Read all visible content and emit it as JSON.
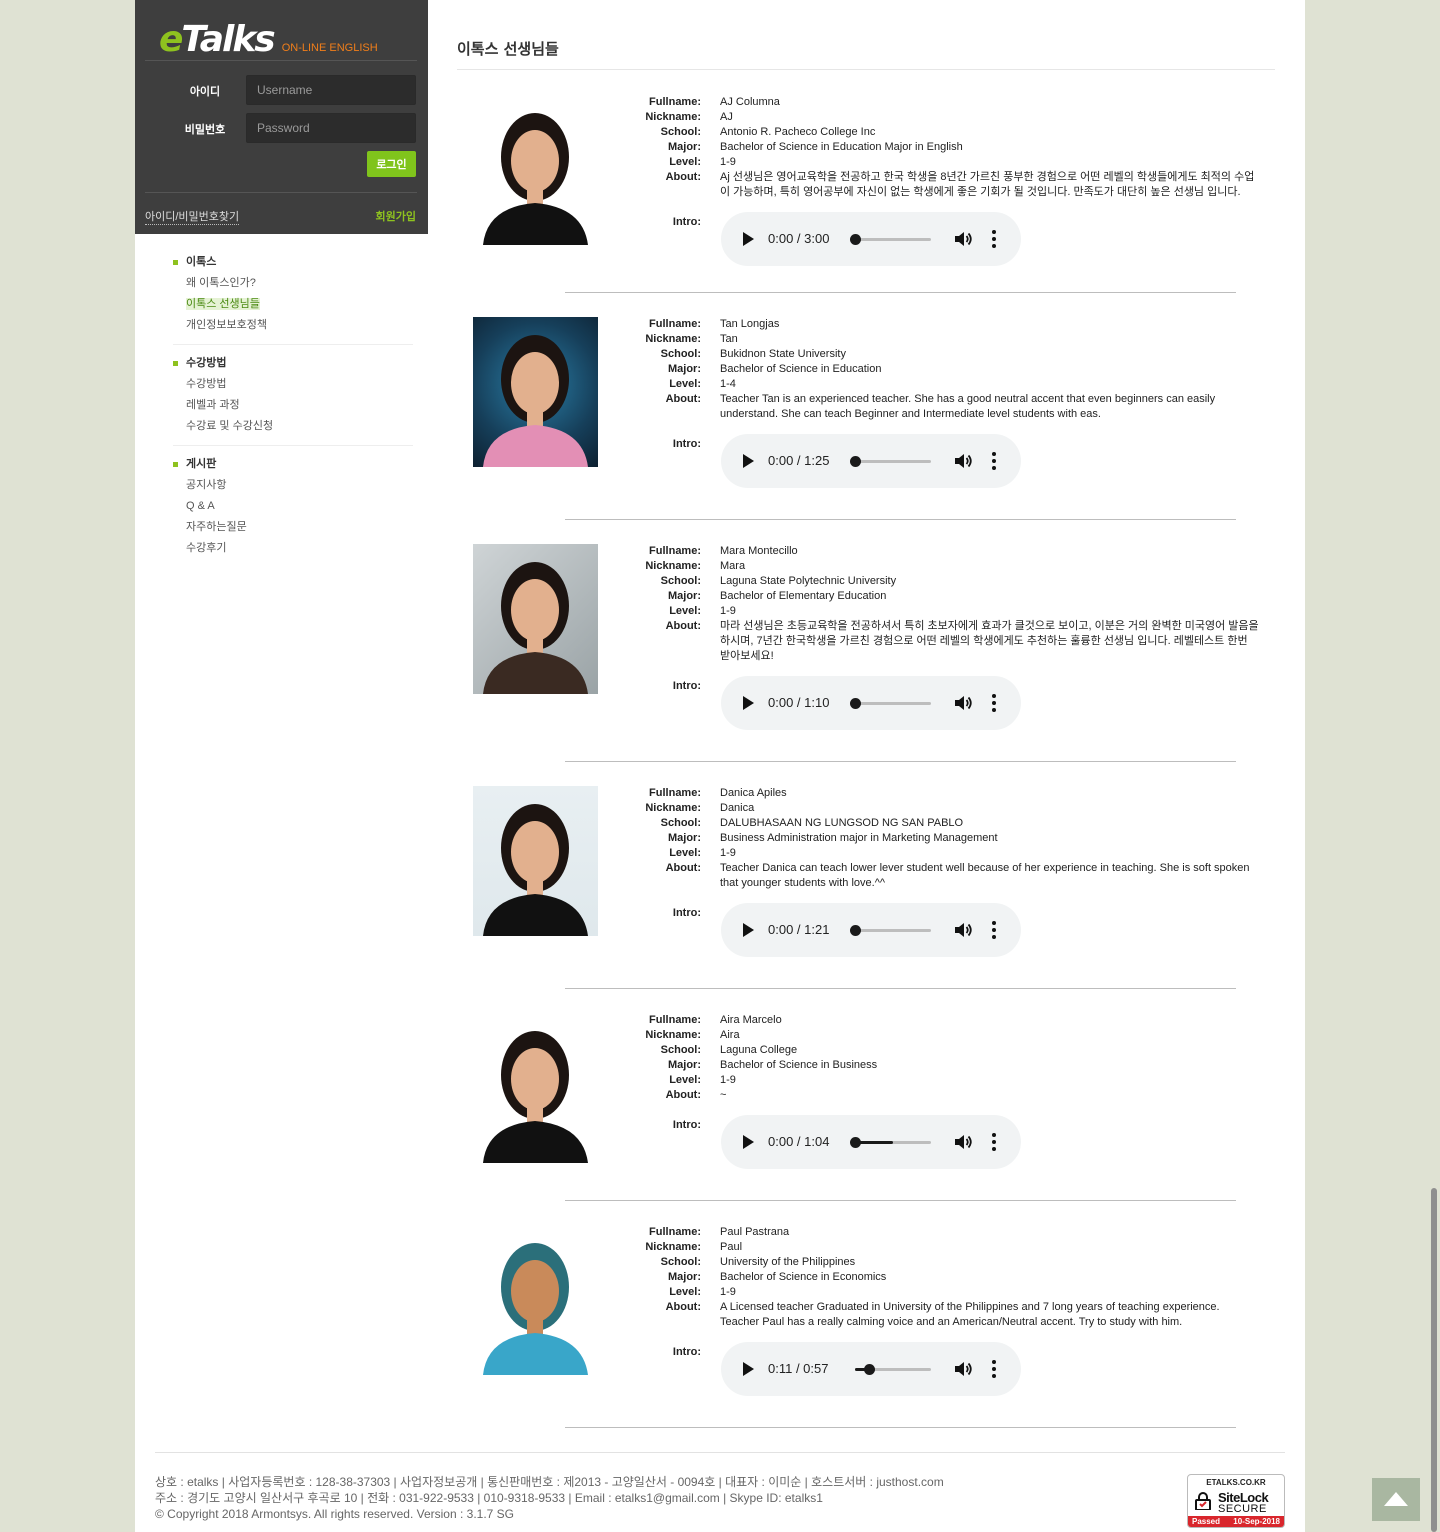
{
  "logo": {
    "e": "e",
    "talks": "Talks",
    "sub": "ON-LINE ENGLISH"
  },
  "login": {
    "id_label": "아이디",
    "id_placeholder": "Username",
    "pw_label": "비밀번호",
    "pw_placeholder": "Password",
    "button": "로그인",
    "find": "아이디/비밀번호찾기",
    "join": "회원가입"
  },
  "menu": [
    {
      "head": "이톡스",
      "items": [
        "왜 이톡스인가?",
        "이톡스 선생님들",
        "개인정보보호정책"
      ]
    },
    {
      "head": "수강방법",
      "items": [
        "수강방법",
        "레벨과 과정",
        "수강료 및 수강신청"
      ]
    },
    {
      "head": "게시판",
      "items": [
        "공지사항",
        "Q & A",
        "자주하는질문",
        "수강후기"
      ]
    }
  ],
  "page_title": "이톡스 선생님들",
  "labels": {
    "fullname": "Fullname:",
    "nickname": "Nickname:",
    "school": "School:",
    "major": "Major:",
    "level": "Level:",
    "about": "About:",
    "intro": "Intro:"
  },
  "teachers": [
    {
      "fullname": "AJ Columna",
      "nickname": "AJ",
      "school": "Antonio R. Pacheco College Inc",
      "major": "Bachelor of Science in Education Major in English",
      "level": "1-9",
      "about": "Aj 선생님은 영어교육학을 전공하고 한국 학생을 8년간 가르친 풍부한 경험으로 어떤 레벨의 학생들에게도 최적의 수업이 가능하며, 특히 영어공부에 자신이 없는 학생에게 좋은 기회가 될 것입니다. 만족도가 대단히 높은 선생님 입니다.",
      "audio_time": "0:00 / 3:00",
      "progress": 0.0
    },
    {
      "fullname": "Tan Longjas",
      "nickname": "Tan",
      "school": "Bukidnon State University",
      "major": "Bachelor of Science in Education",
      "level": "1-4",
      "about": "Teacher Tan is an experienced teacher. She has a good neutral accent that even beginners can easily understand. She can teach Beginner and Intermediate level students with eas.",
      "audio_time": "0:00 / 1:25",
      "progress": 0.0
    },
    {
      "fullname": "Mara Montecillo",
      "nickname": "Mara",
      "school": "Laguna State Polytechnic University",
      "major": "Bachelor of Elementary Education",
      "level": "1-9",
      "about": "마라 선생님은 초등교육학을 전공하셔서 특히 초보자에게 효과가 클것으로 보이고, 이분은 거의 완벽한 미국영어 발음을 하시며, 7년간 한국학생을 가르친 경험으로 어떤 레벨의 학생에게도 추천하는 훌륭한 선생님 입니다. 레벨테스트 한번 받아보세요!",
      "audio_time": "0:00 / 1:10",
      "progress": 0.0
    },
    {
      "fullname": "Danica Apiles",
      "nickname": "Danica",
      "school": "DALUBHASAAN NG LUNGSOD NG SAN PABLO",
      "major": "Business Administration major in Marketing Management",
      "level": "1-9",
      "about": "Teacher Danica can teach lower lever student well because of her experience in teaching. She is soft spoken that younger students with love.^^",
      "audio_time": "0:00 / 1:21",
      "progress": 0.0
    },
    {
      "fullname": "Aira Marcelo",
      "nickname": "Aira",
      "school": "Laguna College",
      "major": "Bachelor of Science in Business",
      "level": "1-9",
      "about": "~",
      "audio_time": "0:00 / 1:04",
      "progress": 0.0,
      "buffered": 0.5
    },
    {
      "fullname": "Paul Pastrana",
      "nickname": "Paul",
      "school": "University of the Philippines",
      "major": "Bachelor of Science in Economics",
      "level": "1-9",
      "about": "A Licensed teacher Graduated in University of the Philippines and 7 long years of teaching experience. Teacher Paul has a really calming voice and an American/Neutral accent. Try to study with him.",
      "audio_time": "0:11 / 0:57",
      "progress": 0.19
    }
  ],
  "footer": {
    "line1": "상호 : etalks | 사업자등록번호 : 128-38-37303 | 사업자정보공개 | 통신판매번호 : 제2013 - 고양일산서 - 0094호 | 대표자 : 이미순 | 호스트서버 : justhost.com",
    "line2": "주소 : 경기도 고양시 일산서구 후곡로 10 | 전화 : 031-922-9533 | 010-9318-9533 | Email : etalks1@gmail.com | Skype ID: etalks1",
    "line3": "© Copyright 2018 Armontsys. All rights reserved. Version : 3.1.7 SG"
  },
  "sitelock": {
    "domain": "ETALKS.CO.KR",
    "name": "SiteLock",
    "secure": "SECURE",
    "passed": "Passed",
    "date": "10-Sep-2018"
  },
  "colors": {
    "accent": "#8ec21f",
    "sidebar_bg": "#3e3e3e",
    "page_bg": "#dfe2d3",
    "logo_sub": "#f07e1a"
  }
}
